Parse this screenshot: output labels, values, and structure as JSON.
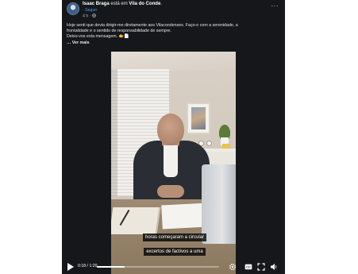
{
  "post": {
    "author": "Isaac Braga",
    "location_prefix": "está em",
    "location": "Vila do Conde",
    "location_suffix": ".",
    "follow_label": "Seguir",
    "time": "4 h",
    "privacy_icon": "globe-icon",
    "more_icon": "more-dots-icon",
    "more_label": "···",
    "caption_lines": [
      "Hoje senti que devia dirigir-me diretamente aos Vilacondenses. Faço-o com a serenidade, a",
      "frontalidade e o sentido de responsabilidade de sempre.",
      "Deixo-vos esta mensagem. 🫱📄"
    ],
    "see_more_label": "Ver mais"
  },
  "video": {
    "subtitle_lines": [
      "horas começaram a circular",
      "excertos de factivos a uma"
    ],
    "current_time": "0:18",
    "duration": "1:20",
    "time_separator": " / ",
    "progress": 0.225,
    "icons": [
      "play-icon",
      "settings-icon",
      "captions-icon",
      "fullscreen-icon",
      "volume-icon"
    ]
  },
  "colors": {
    "post_background": "#16171a",
    "link": "#4599ff",
    "text": "#e4e6eb"
  }
}
